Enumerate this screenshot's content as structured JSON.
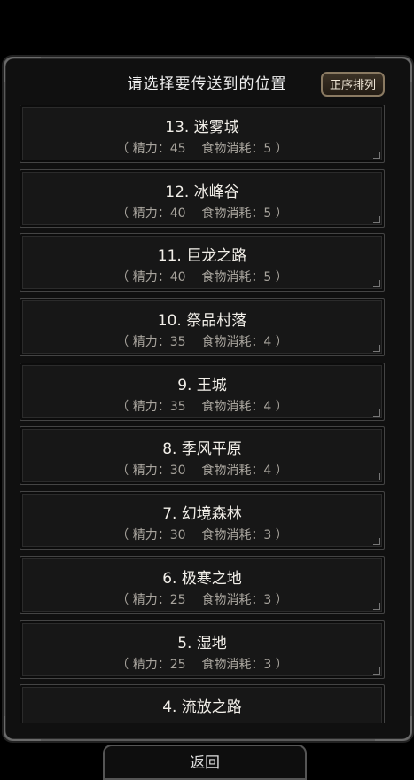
{
  "header": {
    "title": "请选择要传送到的位置",
    "sort_label": "正序排列"
  },
  "locations": [
    {
      "name": "13. 迷雾城",
      "cost": "（ 精力：45    食物消耗：5 ）"
    },
    {
      "name": "12. 冰峰谷",
      "cost": "（ 精力：40    食物消耗：5 ）"
    },
    {
      "name": "11. 巨龙之路",
      "cost": "（ 精力：40    食物消耗：5 ）"
    },
    {
      "name": "10. 祭品村落",
      "cost": "（ 精力：35    食物消耗：4 ）"
    },
    {
      "name": "9. 王城",
      "cost": "（ 精力：35    食物消耗：4 ）"
    },
    {
      "name": "8. 季风平原",
      "cost": "（ 精力：30    食物消耗：4 ）"
    },
    {
      "name": "7. 幻境森林",
      "cost": "（ 精力：30    食物消耗：3 ）"
    },
    {
      "name": "6. 极寒之地",
      "cost": "（ 精力：25    食物消耗：3 ）"
    },
    {
      "name": "5. 湿地",
      "cost": "（ 精力：25    食物消耗：3 ）"
    },
    {
      "name": "4. 流放之路",
      "cost": ""
    }
  ],
  "footer": {
    "back_label": "返回"
  }
}
